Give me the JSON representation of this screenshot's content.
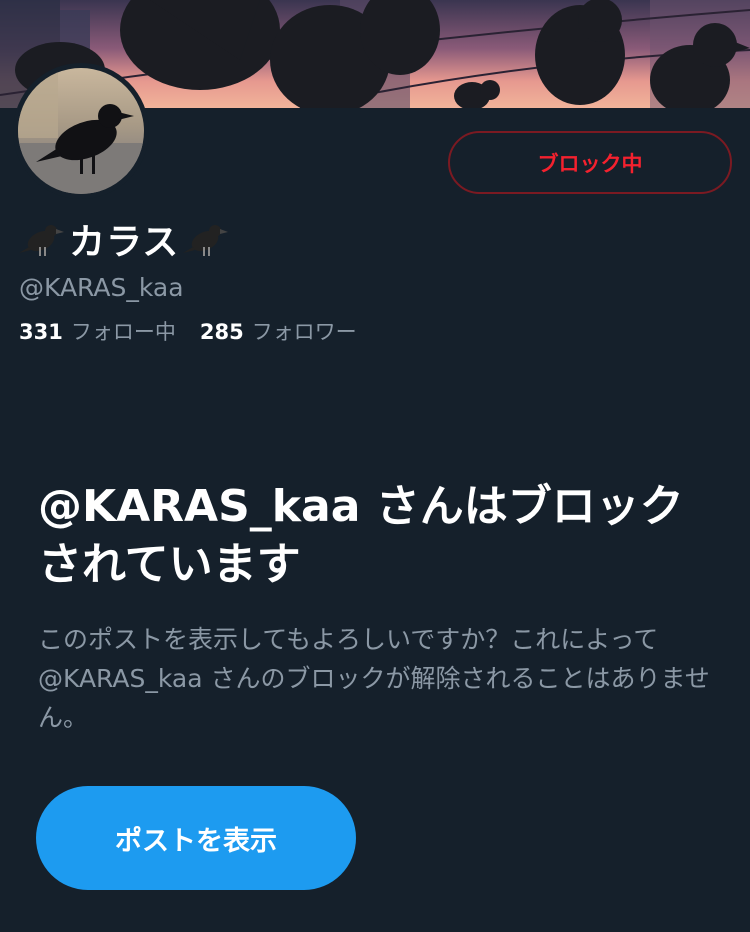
{
  "profile": {
    "display_name": "カラス",
    "handle": "@KARAS_kaa",
    "following_count": "331",
    "following_label": "フォロー中",
    "followers_count": "285",
    "followers_label": "フォロワー"
  },
  "actions": {
    "block_status_label": "ブロック中",
    "show_posts_label": "ポストを表示"
  },
  "notice": {
    "headline": "@KARAS_kaa さんはブロックされています",
    "body": "このポストを表示してもよろしいですか？これによって @KARAS_kaa さんのブロックが解除されることはありません。"
  },
  "icons": {
    "name_prefix": "crow-emoji-icon",
    "name_suffix": "crow-emoji-icon"
  },
  "colors": {
    "background": "#15202b",
    "accent": "#1d9bf0",
    "block_red": "#f4212e",
    "secondary_text": "#8b98a5"
  }
}
